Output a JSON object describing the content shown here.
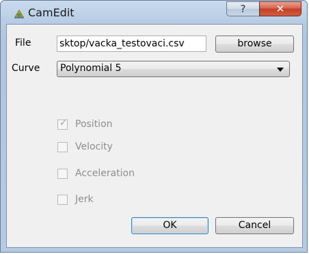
{
  "window": {
    "title": "CamEdit",
    "help_label": "?",
    "close_label": "✕"
  },
  "form": {
    "file_label": "File",
    "file_value": "sktop/vacka_testovaci.csv",
    "browse_label": "browse",
    "curve_label": "Curve",
    "curve_selected": "Polynomial 5",
    "options": [
      {
        "label": "Position",
        "checked": true,
        "enabled": false
      },
      {
        "label": "Velocity",
        "checked": false,
        "enabled": false
      },
      {
        "label": "Acceleration",
        "checked": false,
        "enabled": false
      },
      {
        "label": "Jerk",
        "checked": false,
        "enabled": false
      }
    ],
    "ok_label": "OK",
    "cancel_label": "Cancel"
  },
  "icons": {
    "app": "cam-edit-app-icon",
    "help": "help-icon",
    "close": "close-icon",
    "dropdown": "chevron-down-icon",
    "check": "checkmark-icon"
  }
}
